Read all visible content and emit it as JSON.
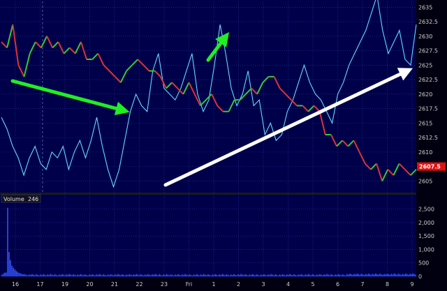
{
  "chart_data": {
    "type": "line",
    "price_axis": {
      "ticks": [
        "2605",
        "2607.5",
        "2610",
        "2612.5",
        "2615",
        "2617.5",
        "2620",
        "2622.5",
        "2625",
        "2627.5",
        "2630",
        "2632.5",
        "2635"
      ],
      "range": [
        2603,
        2636
      ]
    },
    "volume_axis": {
      "ticks": [
        "0",
        "500",
        "1,000",
        "1,500",
        "2,000",
        "2,500"
      ],
      "range": [
        0,
        2700
      ]
    },
    "x_ticks": [
      "16",
      "17",
      "19",
      "20",
      "21",
      "22",
      "23",
      "Fri",
      "1",
      "2",
      "3",
      "4",
      "5",
      "6",
      "7",
      "8",
      "9"
    ],
    "volume_label": "Volume",
    "volume_value": "246",
    "last_price_label": "2607.5",
    "colors": {
      "background": "#00004a",
      "grid": "#2a3a9a",
      "indicator": "#66d9ff",
      "price_up": "#33cc33",
      "price_down": "#dd3333",
      "volume": "#3355ff",
      "price_tag": "#dd1111",
      "annotation_arrow_green": "#22ee22",
      "annotation_arrow_white": "#ffffff"
    },
    "series": [
      {
        "kind": "price",
        "values": [
          2629,
          2628,
          2632,
          2625,
          2623,
          2627,
          2629,
          2628,
          2630,
          2628,
          2629,
          2627,
          2628,
          2627,
          2629,
          2626,
          2626,
          2627,
          2625,
          2624,
          2623,
          2622,
          2624,
          2625,
          2626,
          2625,
          2624,
          2624,
          2623,
          2621,
          2622,
          2621,
          2620,
          2622,
          2620,
          2618,
          2619,
          2620,
          2618,
          2617,
          2617,
          2619,
          2619,
          2620,
          2621,
          2620,
          2622,
          2623,
          2623,
          2621,
          2620,
          2619,
          2618,
          2618,
          2617,
          2618,
          2617,
          2613,
          2613,
          2611,
          2612,
          2611,
          2612,
          2610,
          2608,
          2607,
          2608,
          2605,
          2607,
          2606,
          2608,
          2607,
          2606,
          2607
        ]
      },
      {
        "kind": "indicator",
        "values": [
          2616,
          2614,
          2611,
          2609,
          2606,
          2609,
          2611,
          2608,
          2607,
          2610,
          2609,
          2611,
          2607,
          2610,
          2612,
          2609,
          2612,
          2616,
          2611,
          2607,
          2604,
          2607,
          2612,
          2617,
          2620,
          2618,
          2617,
          2624,
          2627,
          2621,
          2620,
          2619,
          2621,
          2624,
          2627,
          2620,
          2617,
          2619,
          2625,
          2632,
          2627,
          2621,
          2618,
          2620,
          2624,
          2618,
          2619,
          2613,
          2615,
          2612,
          2613,
          2617,
          2619,
          2622,
          2625,
          2622,
          2620,
          2619,
          2617,
          2615,
          2620,
          2622,
          2625,
          2627,
          2629,
          2631,
          2634,
          2637,
          2631,
          2627,
          2629,
          2631,
          2626,
          2625,
          2632
        ]
      }
    ]
  }
}
